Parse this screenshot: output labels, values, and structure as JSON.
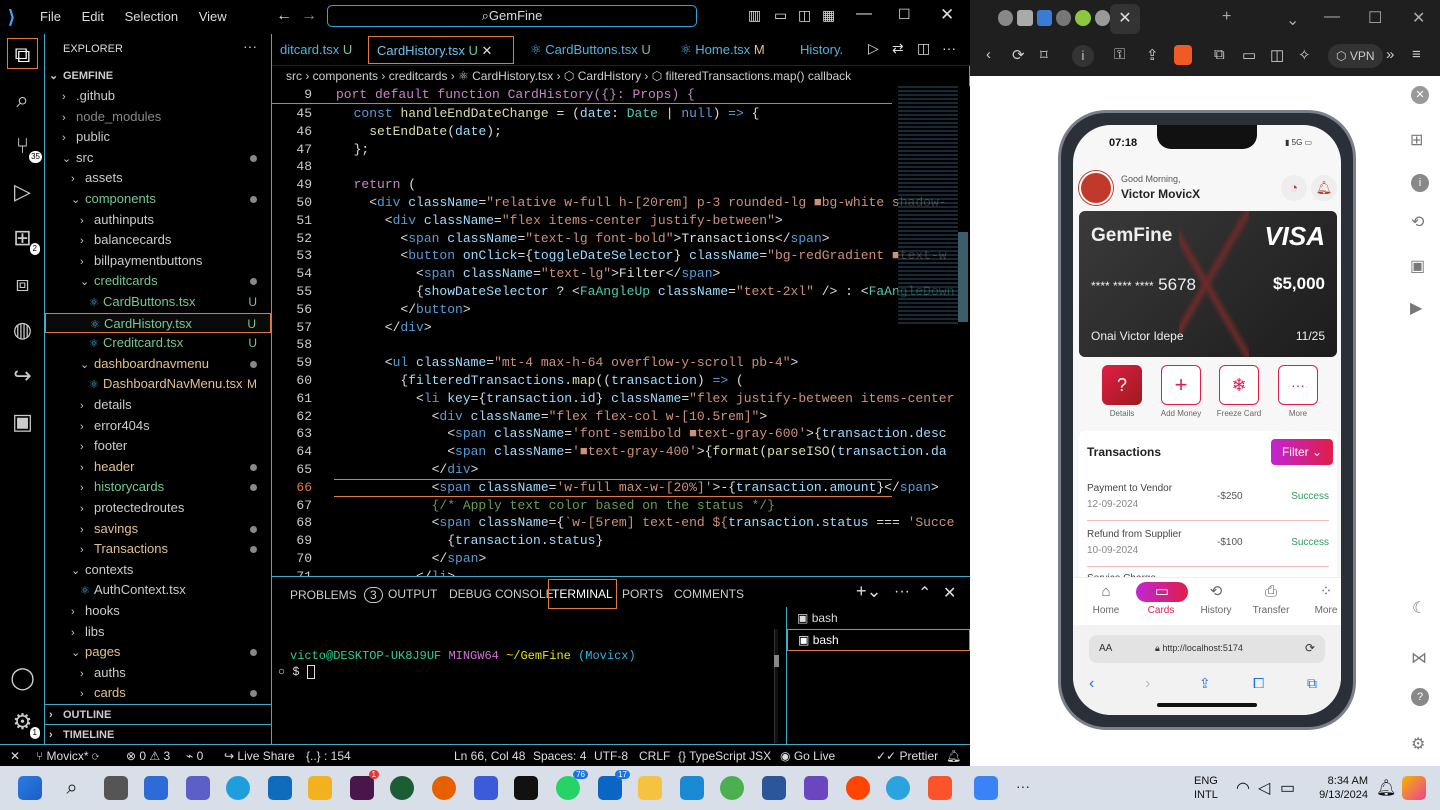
{
  "vscode": {
    "menu": [
      "File",
      "Edit",
      "Selection",
      "View"
    ],
    "command_center": "GemFine",
    "explorer_title": "EXPLORER",
    "project": "GEMFINE",
    "tree": [
      {
        "label": ".github",
        "indent": 1,
        "chev": "›"
      },
      {
        "label": "node_modules",
        "indent": 1,
        "chev": "›",
        "dim": true
      },
      {
        "label": "public",
        "indent": 1,
        "chev": "›"
      },
      {
        "label": "src",
        "indent": 1,
        "chev": "⌄",
        "dot": true
      },
      {
        "label": "assets",
        "indent": 2,
        "chev": "›"
      },
      {
        "label": "components",
        "indent": 2,
        "chev": "⌄",
        "dot": true,
        "color": "green"
      },
      {
        "label": "authinputs",
        "indent": 3,
        "chev": "›"
      },
      {
        "label": "balancecards",
        "indent": 3,
        "chev": "›"
      },
      {
        "label": "billpaymentbuttons",
        "indent": 3,
        "chev": "›"
      },
      {
        "label": "creditcards",
        "indent": 3,
        "chev": "⌄",
        "dot": true,
        "color": "green"
      },
      {
        "label": "CardButtons.tsx",
        "indent": 4,
        "file": true,
        "badge": "U",
        "color": "green"
      },
      {
        "label": "CardHistory.tsx",
        "indent": 4,
        "file": true,
        "badge": "U",
        "color": "green",
        "selected": true
      },
      {
        "label": "Creditcard.tsx",
        "indent": 4,
        "file": true,
        "badge": "U",
        "color": "green"
      },
      {
        "label": "dashboardnavmenu",
        "indent": 3,
        "chev": "⌄",
        "dot": true,
        "color": "orange"
      },
      {
        "label": "DashboardNavMenu.tsx",
        "indent": 4,
        "file": true,
        "badge": "M",
        "color": "orange"
      },
      {
        "label": "details",
        "indent": 3,
        "chev": "›"
      },
      {
        "label": "error404s",
        "indent": 3,
        "chev": "›"
      },
      {
        "label": "footer",
        "indent": 3,
        "chev": "›"
      },
      {
        "label": "header",
        "indent": 3,
        "chev": "›",
        "dot": true,
        "color": "orange"
      },
      {
        "label": "historycards",
        "indent": 3,
        "chev": "›",
        "dot": true,
        "color": "green"
      },
      {
        "label": "protectedroutes",
        "indent": 3,
        "chev": "›"
      },
      {
        "label": "savings",
        "indent": 3,
        "chev": "›",
        "dot": true,
        "color": "orange"
      },
      {
        "label": "Transactions",
        "indent": 3,
        "chev": "›",
        "dot": true,
        "color": "orange"
      },
      {
        "label": "contexts",
        "indent": 2,
        "chev": "⌄"
      },
      {
        "label": "AuthContext.tsx",
        "indent": 3,
        "file": true
      },
      {
        "label": "hooks",
        "indent": 2,
        "chev": "›"
      },
      {
        "label": "libs",
        "indent": 2,
        "chev": "›"
      },
      {
        "label": "pages",
        "indent": 2,
        "chev": "⌄",
        "dot": true,
        "color": "orange"
      },
      {
        "label": "auths",
        "indent": 3,
        "chev": "›"
      },
      {
        "label": "cards",
        "indent": 3,
        "chev": "›",
        "dot": true,
        "color": "orange"
      }
    ],
    "outline": "OUTLINE",
    "timeline": "TIMELINE",
    "tabs": [
      {
        "label": "ditcard.tsx",
        "badge": "U"
      },
      {
        "label": "CardHistory.tsx",
        "badge": "U",
        "active": true
      },
      {
        "label": "CardButtons.tsx",
        "badge": "U"
      },
      {
        "label": "Home.tsx",
        "badge": "M"
      },
      {
        "label": "History."
      }
    ],
    "breadcrumb": "src › components › creditcards › ⚛ CardHistory.tsx › ⬡ CardHistory › ⬡ filteredTransactions.map() callback",
    "sticky": {
      "num": "9",
      "code": "port default function CardHistory({}: Props) {"
    },
    "lines": [
      {
        "n": "45",
        "h": "  <span class='kb'>const</span> <span class='fn'>handleEndDateChange</span> = (<span class='at'>date</span>: <span class='tg'>Date</span> | <span class='kb'>null</span>) <span class='kb'>=></span> {"
      },
      {
        "n": "46",
        "h": "    <span class='fn'>setEndDate</span>(<span class='at'>date</span>);"
      },
      {
        "n": "47",
        "h": "  };"
      },
      {
        "n": "48",
        "h": ""
      },
      {
        "n": "49",
        "h": "  <span class='kw'>return</span> ("
      },
      {
        "n": "50",
        "h": "    &lt;<span class='kb'>div</span> <span class='at'>className</span>=<span class='st'>\"relative w-full h-[20rem] p-3 rounded-lg ■bg-white shadow-</span>"
      },
      {
        "n": "51",
        "h": "      &lt;<span class='kb'>div</span> <span class='at'>className</span>=<span class='st'>\"flex items-center justify-between\"</span>&gt;"
      },
      {
        "n": "52",
        "h": "        &lt;<span class='kb'>span</span> <span class='at'>className</span>=<span class='st'>\"text-lg font-bold\"</span>&gt;Transactions&lt;/<span class='kb'>span</span>&gt;"
      },
      {
        "n": "53",
        "h": "        &lt;<span class='kb'>button</span> <span class='at'>onClick</span>={<span class='at'>toggleDateSelector</span>} <span class='at'>className</span>=<span class='st'>\"bg-redGradient ■text-w</span>"
      },
      {
        "n": "54",
        "h": "          &lt;<span class='kb'>span</span> <span class='at'>className</span>=<span class='st'>\"text-lg\"</span>&gt;Filter&lt;/<span class='kb'>span</span>&gt;"
      },
      {
        "n": "55",
        "h": "          {<span class='at'>showDateSelector</span> ? &lt;<span class='tg'>FaAngleUp</span> <span class='at'>className</span>=<span class='st'>\"text-2xl\"</span> /&gt; : &lt;<span class='tg'>FaAngleDown</span>"
      },
      {
        "n": "56",
        "h": "        &lt;/<span class='kb'>button</span>&gt;"
      },
      {
        "n": "57",
        "h": "      &lt;/<span class='kb'>div</span>&gt;"
      },
      {
        "n": "58",
        "h": ""
      },
      {
        "n": "59",
        "h": "      &lt;<span class='kb'>ul</span> <span class='at'>className</span>=<span class='st'>\"mt-4 max-h-64 overflow-y-scroll pb-4\"</span>&gt;"
      },
      {
        "n": "60",
        "h": "        {<span class='at'>filteredTransactions</span>.<span class='fn'>map</span>((<span class='at'>transaction</span>) <span class='kb'>=></span> ("
      },
      {
        "n": "61",
        "h": "          &lt;<span class='kb'>li</span> <span class='at'>key</span>={<span class='at'>transaction</span>.<span class='at'>id</span>} <span class='at'>className</span>=<span class='st'>\"flex justify-between items-center</span>"
      },
      {
        "n": "62",
        "h": "            &lt;<span class='kb'>div</span> <span class='at'>className</span>=<span class='st'>\"flex flex-col w-[10.5rem]\"</span>&gt;"
      },
      {
        "n": "63",
        "h": "              &lt;<span class='kb'>span</span> <span class='at'>className</span>=<span class='st'>'font-semibold ■text-gray-600'</span>&gt;{<span class='at'>transaction</span>.<span class='at'>desc</span>"
      },
      {
        "n": "64",
        "h": "              &lt;<span class='kb'>span</span> <span class='at'>className</span>=<span class='st'>'■text-gray-400'</span>&gt;{<span class='fn'>format</span>(<span class='fn'>parseISO</span>(<span class='at'>transaction</span>.<span class='at'>da</span>"
      },
      {
        "n": "65",
        "h": "            &lt;/<span class='kb'>div</span>&gt;"
      },
      {
        "n": "66",
        "h": "            &lt;<span class='kb'>span</span> <span class='at'>className</span>=<span class='st'>'w-full max-w-[20%]'</span>&gt;-{<span class='at'>transaction</span>.<span class='at'>amount</span>}&lt;/<span class='kb'>span</span>&gt;",
        "hl": true
      },
      {
        "n": "67",
        "h": "            <span class='cm'>{/* Apply text color based on the status */}</span>"
      },
      {
        "n": "68",
        "h": "            &lt;<span class='kb'>span</span> <span class='at'>className</span>={<span class='st'>`w-[5rem] text-end ${</span><span class='at'>transaction</span>.<span class='at'>status</span> === <span class='st'>'Succe</span>"
      },
      {
        "n": "69",
        "h": "              {<span class='at'>transaction</span>.<span class='at'>status</span>}"
      },
      {
        "n": "70",
        "h": "            &lt;/<span class='kb'>span</span>&gt;"
      },
      {
        "n": "71",
        "h": "          &lt;/<span class='kb'>li</span>&gt;"
      }
    ],
    "panel": {
      "tabs": [
        "PROBLEMS",
        "OUTPUT",
        "DEBUG CONSOLE",
        "TERMINAL",
        "PORTS",
        "COMMENTS"
      ],
      "problems_count": "3",
      "prompt_user": "victo@DESKTOP-UK8J9UF",
      "prompt_env": "MINGW64",
      "prompt_path": "~/GemFine",
      "prompt_branch": "(Movicx)",
      "prompt_symbol": "$",
      "terminals": [
        "bash",
        "bash"
      ]
    },
    "status": {
      "branch": "Movicx*",
      "errors": "0",
      "warnings": "3",
      "ports": "0",
      "live_share": "Live Share",
      "braces": "{..} : 154",
      "position": "Ln 66, Col 48",
      "spaces": "Spaces: 4",
      "encoding": "UTF-8",
      "eol": "CRLF",
      "lang": "TypeScript JSX",
      "go_live": "Go Live",
      "prettier": "Prettier"
    },
    "activity_badges": {
      "scm": "35",
      "extensions": "2",
      "accounts": "1"
    }
  },
  "browser": {
    "vpn": "VPN",
    "phone": {
      "time": "07:18",
      "signal": "5G",
      "greeting": "Good Morning,",
      "user": "Victor MovicX",
      "card": {
        "brand": "GemFine",
        "network": "VISA",
        "number": "**** **** ****",
        "last4": "5678",
        "balance": "$5,000",
        "holder": "Onai Victor Idepe",
        "expiry": "11/25"
      },
      "actions": [
        "Details",
        "Add Money",
        "Freeze Card",
        "More"
      ],
      "transactions_title": "Transactions",
      "filter": "Filter",
      "transactions": [
        {
          "desc": "Payment to Vendor",
          "date": "12-09-2024",
          "amount": "-$250",
          "status": "Success"
        },
        {
          "desc": "Refund from Supplier",
          "date": "10-09-2024",
          "amount": "-$100",
          "status": "Success"
        }
      ],
      "partial_text": "Service Charge",
      "nav": [
        "Home",
        "Cards",
        "History",
        "Transfer",
        "More"
      ],
      "url": "http://localhost:5174",
      "aa": "AA"
    }
  },
  "taskbar": {
    "lang": "ENG",
    "lang2": "INTL",
    "time": "8:34 AM",
    "date": "9/13/2024",
    "badge_whatsapp": "76",
    "badge_linkedin": "17",
    "badge_slack": "1"
  }
}
